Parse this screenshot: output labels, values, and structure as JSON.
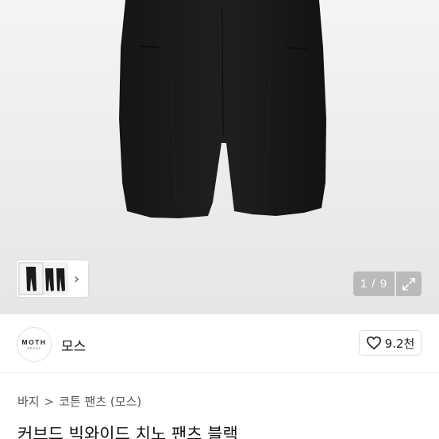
{
  "gallery": {
    "page_current": "1",
    "page_total": "9",
    "page_label": "1 / 9"
  },
  "brand": {
    "logo_text": "MOTH",
    "logo_subtext": "SEOUL",
    "name": "모스"
  },
  "like": {
    "count": "9.2천"
  },
  "breadcrumb": {
    "items": [
      "바지",
      "코튼 팬츠 (모스)"
    ],
    "separator": ">"
  },
  "product": {
    "title": "커브드 빅와이드 치노 팬츠 블랙"
  },
  "icons": {
    "thumb_next": "chevron-right-icon",
    "expand": "expand-icon",
    "like": "heart-icon"
  }
}
